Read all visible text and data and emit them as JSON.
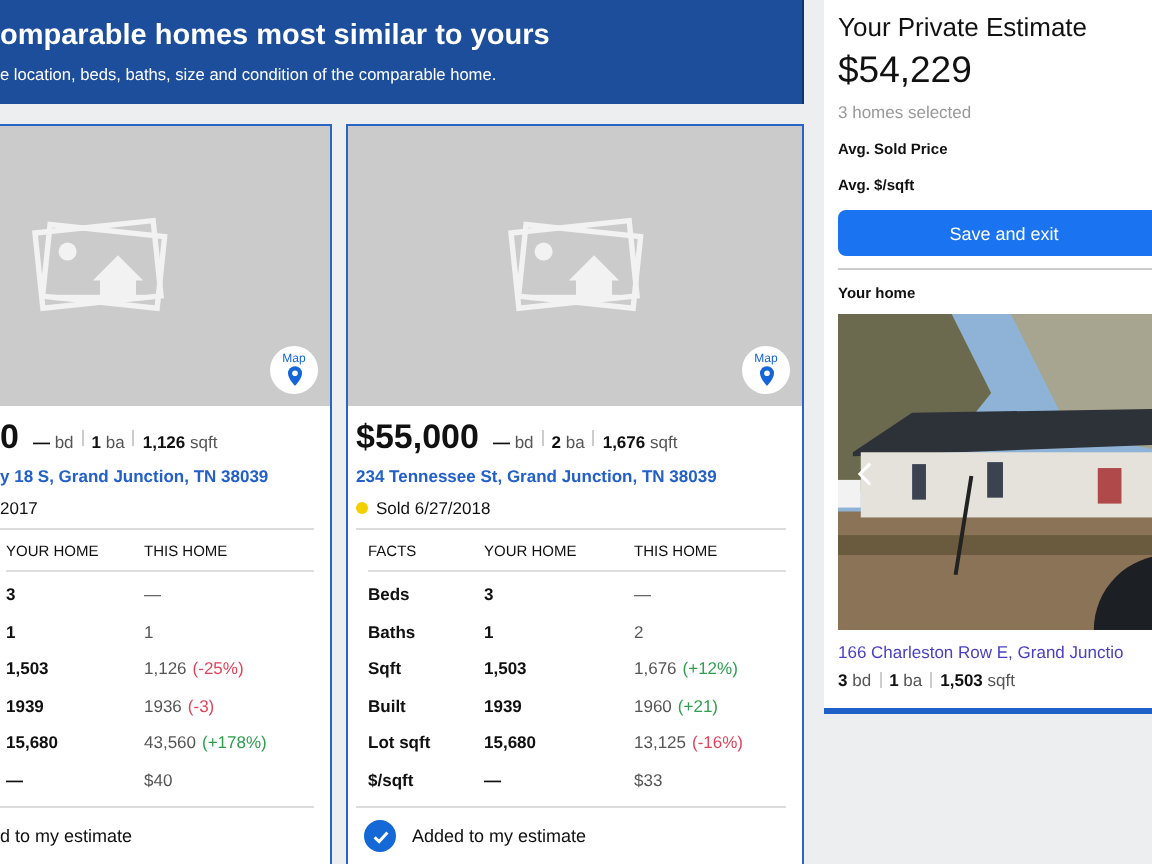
{
  "header": {
    "title": "omparable homes most similar to yours",
    "subtitle": "e location, beds, baths, size and condition of the comparable home."
  },
  "cards": [
    {
      "kind": "partial",
      "selected": true,
      "map_label": "Map",
      "price": "0",
      "stats": [
        {
          "value": "—",
          "unit": "bd"
        },
        {
          "value": "1",
          "unit": "ba"
        },
        {
          "value": "1,126",
          "unit": "sqft"
        }
      ],
      "address": "y 18 S, Grand Junction, TN 38039",
      "sold": {
        "text": "2017"
      },
      "columns": [
        "YOUR HOME",
        "THIS HOME"
      ],
      "rows": [
        {
          "yours": "3",
          "this": "—"
        },
        {
          "yours": "1",
          "this": "1"
        },
        {
          "yours": "1,503",
          "this": "1,126",
          "diff": "(-25%)",
          "color": "#e0435a"
        },
        {
          "yours": "1939",
          "this": "1936",
          "diff": "(-3)",
          "color": "#e0435a"
        },
        {
          "yours": "15,680",
          "this": "43,560",
          "diff": "(+178%)",
          "color": "#2e9e4f"
        },
        {
          "yours": "—",
          "this": "$40"
        }
      ],
      "footer": "d to my estimate"
    },
    {
      "kind": "full",
      "selected": true,
      "map_label": "Map",
      "price": "$55,000",
      "stats": [
        {
          "value": "—",
          "unit": "bd"
        },
        {
          "value": "2",
          "unit": "ba"
        },
        {
          "value": "1,676",
          "unit": "sqft"
        }
      ],
      "address": "234 Tennessee St, Grand Junction, TN 38039",
      "sold": {
        "text": "Sold 6/27/2018",
        "color": "#f5d000"
      },
      "columns": [
        "FACTS",
        "YOUR HOME",
        "THIS HOME"
      ],
      "rows": [
        {
          "fact": "Beds",
          "yours": "3",
          "this": "—"
        },
        {
          "fact": "Baths",
          "yours": "1",
          "this": "2"
        },
        {
          "fact": "Sqft",
          "yours": "1,503",
          "this": "1,676",
          "diff": "(+12%)",
          "color": "#2e9e4f"
        },
        {
          "fact": "Built",
          "yours": "1939",
          "this": "1960",
          "diff": "(+21)",
          "color": "#2e9e4f"
        },
        {
          "fact": "Lot sqft",
          "yours": "15,680",
          "this": "13,125",
          "diff": "(-16%)",
          "color": "#e0435a"
        },
        {
          "fact": "$/sqft",
          "yours": "—",
          "this": "$33"
        }
      ],
      "footer": "Added to my estimate",
      "added": true
    }
  ],
  "estimate": {
    "title": "Your Private Estimate",
    "amount": "$54,229",
    "selected_count": "3 homes selected",
    "metrics": [
      "Avg. Sold Price",
      "Avg. $/sqft"
    ],
    "button": "Save and exit",
    "home_heading": "Your home",
    "home_address": "166 Charleston Row E, Grand Junctio",
    "home_stats": [
      {
        "value": "3",
        "unit": "bd"
      },
      {
        "value": "1",
        "unit": "ba"
      },
      {
        "value": "1,503",
        "unit": "sqft"
      }
    ]
  }
}
